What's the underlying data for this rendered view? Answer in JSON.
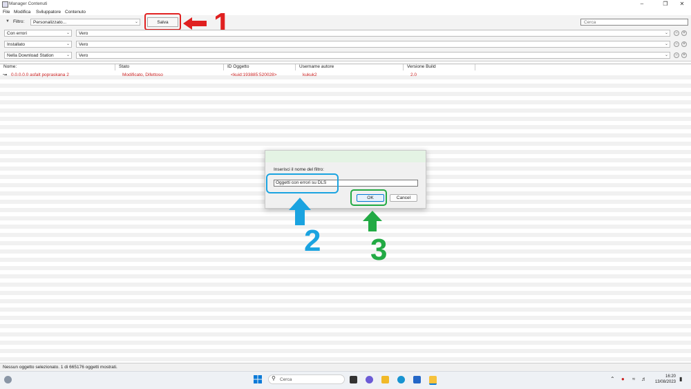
{
  "window": {
    "title": "Manager Contenuti"
  },
  "menu": [
    "File",
    "Modifica",
    "Sviluppatore",
    "Contenuto"
  ],
  "filter": {
    "label": "Filtro:",
    "preset": "Personalizzato...",
    "save_label": "Salva",
    "search_placeholder": "Cerca",
    "rows": [
      {
        "field": "Con errori",
        "value": "Vero"
      },
      {
        "field": "Installato",
        "value": "Vero"
      },
      {
        "field": "Nella Download Station",
        "value": "Vero"
      }
    ]
  },
  "table": {
    "columns": [
      "Nome:",
      "Stato",
      "ID Oggetto",
      "Username autore",
      "Versione Build"
    ],
    "rows": [
      {
        "name": "0.0.0.0.0 asfalt popraskana 2",
        "state": "Modificato, Difettoso",
        "id": "<kuid:193885:520028>",
        "author": "kukuk2",
        "build": "2.0"
      }
    ]
  },
  "dialog": {
    "prompt": "Inserisci il nome del filtro:",
    "value": "Oggetti con errori su DLS",
    "ok_label": "OK",
    "cancel_label": "Cancel"
  },
  "annotations": {
    "step1": "1",
    "step2": "2",
    "step3": "3"
  },
  "status": {
    "text": "Nessun oggetto selezionato. 1 di 665176 oggetti mostrati."
  },
  "taskbar": {
    "search_placeholder": "Cerca",
    "time": "16:20",
    "date": "13/08/2023"
  },
  "colors": {
    "annotation_red": "#e02020",
    "annotation_blue": "#1aa3e0",
    "annotation_green": "#22aa44",
    "error_text": "#cc2222"
  }
}
